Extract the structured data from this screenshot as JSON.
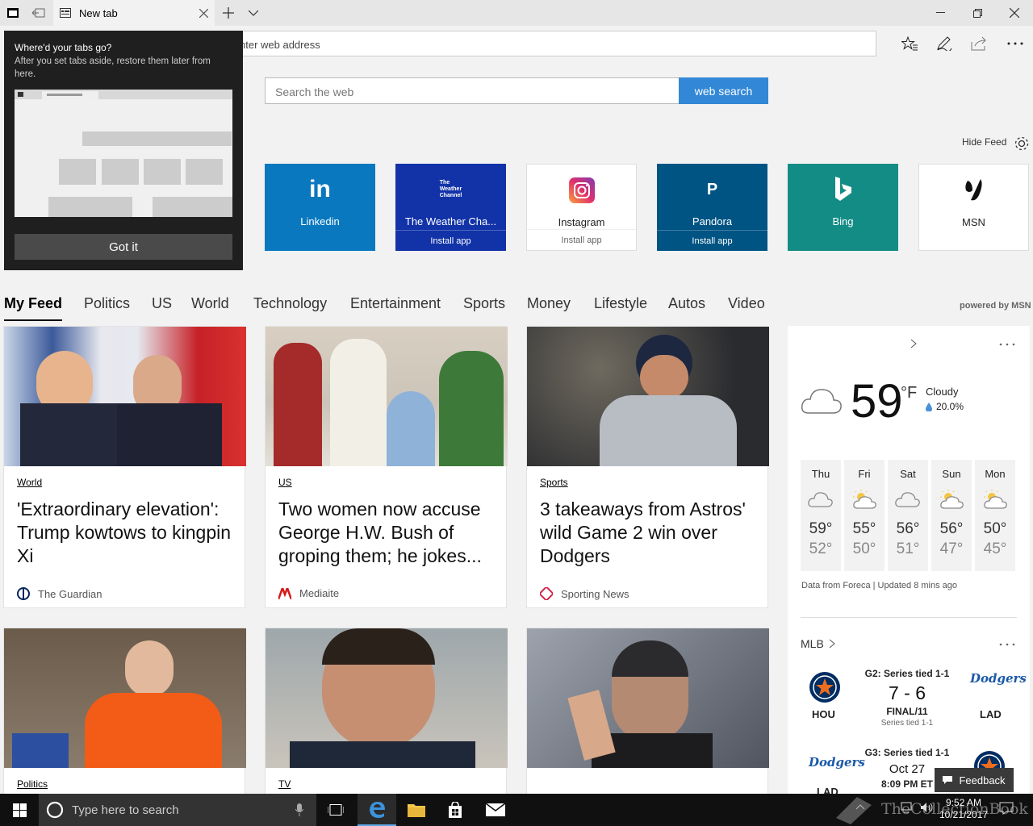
{
  "browser": {
    "tab_title": "New tab",
    "address_placeholder": "Search or enter web address",
    "address_visible": "nter web address"
  },
  "popup": {
    "title": "Where'd your tabs go?",
    "body": "After you set tabs aside, restore them later from here.",
    "button": "Got it"
  },
  "search": {
    "placeholder": "Search the web",
    "button": "web search"
  },
  "hide_feed": "Hide Feed",
  "tiles": [
    {
      "name": "Linkedin",
      "sub": "",
      "color": "#0a78bf",
      "icon": "linkedin-icon"
    },
    {
      "name": "The Weather Cha...",
      "sub": "Install app",
      "color": "#1233a8",
      "icon": "weather-channel-icon",
      "logo": [
        "The",
        "Weather",
        "Channel"
      ]
    },
    {
      "name": "Instagram",
      "sub": "Install app",
      "color": "#ffffff",
      "icon": "instagram-icon"
    },
    {
      "name": "Pandora",
      "sub": "Install app",
      "color": "#005483",
      "icon": "pandora-icon",
      "logo": "P"
    },
    {
      "name": "Bing",
      "sub": "",
      "color": "#148c86",
      "icon": "bing-icon"
    },
    {
      "name": "MSN",
      "sub": "",
      "color": "#ffffff",
      "icon": "msn-icon"
    }
  ],
  "categories": [
    "My Feed",
    "Politics",
    "US",
    "World",
    "Technology",
    "Entertainment",
    "Sports",
    "Money",
    "Lifestyle",
    "Autos",
    "Video"
  ],
  "powered_by": "powered by MSN",
  "cards": [
    {
      "category": "World",
      "headline": "'Extraordinary elevation': Trump kowtows to kingpin Xi",
      "source": "The Guardian",
      "source_icon": "guardian-icon"
    },
    {
      "category": "US",
      "headline": "Two women now accuse George H.W. Bush of groping them; he jokes...",
      "source": "Mediaite",
      "source_icon": "mediaite-icon"
    },
    {
      "category": "Sports",
      "headline": "3 takeaways from Astros' wild Game 2 win over Dodgers",
      "source": "Sporting News",
      "source_icon": "sporting-news-icon"
    },
    {
      "category": "Politics",
      "headline": "",
      "source": ""
    },
    {
      "category": "TV",
      "headline": "",
      "source": ""
    },
    {
      "category": "",
      "headline": "",
      "source": ""
    }
  ],
  "weather": {
    "temp": "59",
    "unit": "°F",
    "condition": "Cloudy",
    "precip": "20.0%",
    "forecast": [
      {
        "day": "Thu",
        "icon": "cloud-icon",
        "hi": "59°",
        "lo": "52°"
      },
      {
        "day": "Fri",
        "icon": "partly-sunny-icon",
        "hi": "55°",
        "lo": "50°"
      },
      {
        "day": "Sat",
        "icon": "cloud-icon",
        "hi": "56°",
        "lo": "51°"
      },
      {
        "day": "Sun",
        "icon": "partly-sunny-icon",
        "hi": "56°",
        "lo": "47°"
      },
      {
        "day": "Mon",
        "icon": "partly-sunny-icon",
        "hi": "50°",
        "lo": "45°"
      }
    ],
    "credit": "Data from Foreca | Updated 8 mins ago"
  },
  "mlb": {
    "title": "MLB",
    "games": [
      {
        "series": "G2: Series tied 1-1",
        "score": "7 - 6",
        "status": "FINAL/11",
        "note": "Series tied 1-1",
        "away": "HOU",
        "home": "LAD"
      },
      {
        "series": "G3: Series tied 1-1",
        "date": "Oct 27",
        "time": "8:09 PM ET",
        "away": "LAD",
        "home": "HOU"
      }
    ]
  },
  "feedback": "Feedback",
  "taskbar": {
    "search_placeholder": "Type here to search",
    "time": "9:52 AM",
    "date": "10/21/2017"
  },
  "watermark": "TheCollectionBook"
}
